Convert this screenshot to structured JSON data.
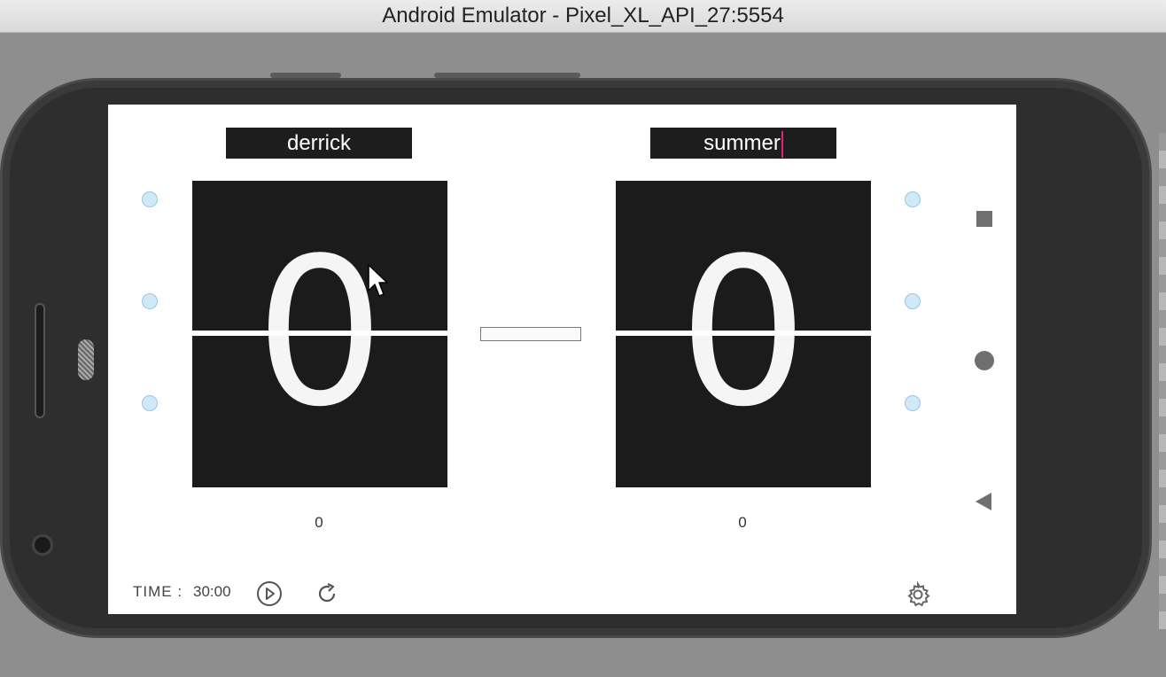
{
  "window": {
    "title": "Android Emulator - Pixel_XL_API_27:5554"
  },
  "scoreboard": {
    "left": {
      "player_name": "derrick",
      "score": "0",
      "sub_score": "0"
    },
    "right": {
      "player_name": "summer",
      "score": "0",
      "sub_score": "0"
    }
  },
  "timer": {
    "label": "TIME :",
    "value": "30:00"
  },
  "icons": {
    "play": "play-circle-icon",
    "reset": "refresh-icon",
    "settings": "gear-icon",
    "nav_recents": "square-icon",
    "nav_home": "circle-icon",
    "nav_back": "triangle-back-icon"
  },
  "colors": {
    "flip_bg": "#1b1b1b",
    "name_bg": "#1d1d1d",
    "dot": "#cfe9f9",
    "caret": "#e0247a"
  }
}
